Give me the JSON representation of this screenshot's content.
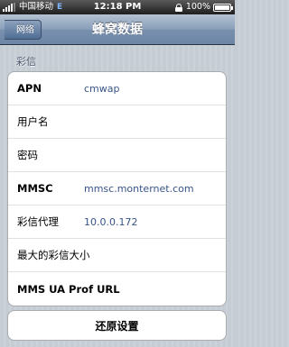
{
  "status_bar": {
    "carrier": "中国移动",
    "network": "E",
    "time": "12:18 PM",
    "battery": "100%",
    "battery_level": 1.0
  },
  "nav": {
    "back_label": "网络",
    "title": "蜂窝数据"
  },
  "section": {
    "header": "彩信"
  },
  "rows": [
    {
      "label": "APN",
      "value": "cmwap"
    },
    {
      "label": "用户名",
      "value": ""
    },
    {
      "label": "密码",
      "value": ""
    },
    {
      "label": "MMSC",
      "value": "mmsc.monternet.com"
    },
    {
      "label": "彩信代理",
      "value": "10.0.0.172"
    },
    {
      "label": "最大的彩信大小",
      "value": ""
    },
    {
      "label": "MMS UA Prof URL",
      "value": ""
    }
  ],
  "reset": {
    "label": "还原设置"
  },
  "colors": {
    "value_text": "#385487",
    "nav_bar": "#6d86a6",
    "background": "#c5ccd4"
  },
  "icons": {
    "signal": "signal-bars-icon",
    "lock": "lock-icon",
    "battery": "battery-icon",
    "back": "back-arrow-icon"
  }
}
